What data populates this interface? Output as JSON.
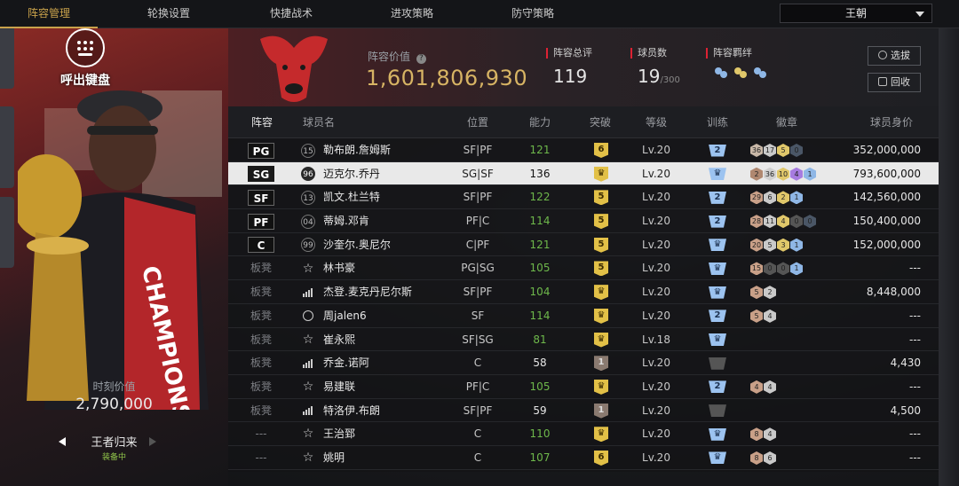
{
  "tabs": [
    {
      "label": "阵容管理",
      "active": true
    },
    {
      "label": "轮换设置",
      "active": false
    },
    {
      "label": "快捷战术",
      "active": false
    },
    {
      "label": "进攻策略",
      "active": false
    },
    {
      "label": "防守策略",
      "active": false
    }
  ],
  "lineup_select": {
    "value": "王朝"
  },
  "left": {
    "keyboard_label": "呼出键盘",
    "value_label": "时刻价值",
    "value": "2,790,000",
    "mode_label": "王者归来",
    "mode_sub": "装备中"
  },
  "header": {
    "lineup_value_label": "阵容价值",
    "lineup_value": "1,601,806,930",
    "total_rating_label": "阵容总评",
    "total_rating": "119",
    "player_count_label": "球员数",
    "player_count": "19",
    "player_count_max": "/300",
    "synergy_label": "阵容羁绊",
    "scout_button": "选拔",
    "recycle_button": "回收"
  },
  "columns": {
    "pos": "阵容",
    "name": "球员名",
    "position": "位置",
    "rating": "能力",
    "breakthrough": "突破",
    "level": "等级",
    "training": "训练",
    "badges": "徽章",
    "value": "球员身价"
  },
  "rows": [
    {
      "pos": "PG",
      "icon": "num",
      "num": "15",
      "name": "勒布朗.詹姆斯",
      "position": "SF|PF",
      "rating": "121",
      "rating_color": "green",
      "brk": "6",
      "brk_color": "gold",
      "level": "Lv.20",
      "train": "2",
      "train_dark": false,
      "badges": [
        [
          "36",
          "#c9b8a8"
        ],
        [
          "17",
          "#c9c9c9"
        ],
        [
          "5",
          "#e0c76a"
        ],
        [
          "0",
          "#4a5666"
        ]
      ],
      "value": "352,000,000"
    },
    {
      "pos": "SG",
      "icon": "num",
      "num": "96",
      "name": "迈克尔.乔丹",
      "position": "SG|SF",
      "rating": "136",
      "rating_color": "white",
      "brk": "♛",
      "brk_color": "gold",
      "level": "Lv.20",
      "train": "♛",
      "train_dark": false,
      "badges": [
        [
          "2",
          "#b08870"
        ],
        [
          "36",
          "#cfcfcf"
        ],
        [
          "10",
          "#e0c76a"
        ],
        [
          "4",
          "#a77ce0"
        ],
        [
          "1",
          "#8fb7e6"
        ]
      ],
      "value": "793,600,000",
      "selected": true
    },
    {
      "pos": "SF",
      "icon": "num",
      "num": "13",
      "name": "凯文.杜兰特",
      "position": "SF|PF",
      "rating": "122",
      "rating_color": "green",
      "brk": "5",
      "brk_color": "gold",
      "level": "Lv.20",
      "train": "2",
      "train_dark": false,
      "badges": [
        [
          "29",
          "#c9a088"
        ],
        [
          "6",
          "#c9c9c9"
        ],
        [
          "2",
          "#e0c76a"
        ],
        [
          "1",
          "#8fb7e6"
        ]
      ],
      "value": "142,560,000"
    },
    {
      "pos": "PF",
      "icon": "num",
      "num": "04",
      "name": "蒂姆.邓肯",
      "position": "PF|C",
      "rating": "114",
      "rating_color": "green",
      "brk": "5",
      "brk_color": "gold",
      "level": "Lv.20",
      "train": "2",
      "train_dark": false,
      "badges": [
        [
          "28",
          "#c9a088"
        ],
        [
          "11",
          "#c9c9c9"
        ],
        [
          "4",
          "#e0c76a"
        ],
        [
          "0",
          "#555"
        ],
        [
          "0",
          "#4a5666"
        ]
      ],
      "value": "150,400,000"
    },
    {
      "pos": "C",
      "icon": "num",
      "num": "99",
      "name": "沙奎尔.奥尼尔",
      "position": "C|PF",
      "rating": "121",
      "rating_color": "green",
      "brk": "5",
      "brk_color": "gold",
      "level": "Lv.20",
      "train": "♛",
      "train_dark": false,
      "badges": [
        [
          "20",
          "#c9a088"
        ],
        [
          "5",
          "#c9c9c9"
        ],
        [
          "3",
          "#e0c76a"
        ],
        [
          "1",
          "#8fb7e6"
        ]
      ],
      "value": "152,000,000"
    },
    {
      "pos": "板凳",
      "icon": "star",
      "num": "",
      "name": "林书豪",
      "position": "PG|SG",
      "rating": "105",
      "rating_color": "green",
      "brk": "5",
      "brk_color": "gold",
      "level": "Lv.20",
      "train": "♛",
      "train_dark": false,
      "badges": [
        [
          "15",
          "#c9a088"
        ],
        [
          "0",
          "#555"
        ],
        [
          "0",
          "#555"
        ],
        [
          "1",
          "#8fb7e6"
        ]
      ],
      "value": "---"
    },
    {
      "pos": "板凳",
      "icon": "sig",
      "num": "",
      "name": "杰登.麦克丹尼尔斯",
      "position": "SF|PF",
      "rating": "104",
      "rating_color": "green",
      "brk": "♛",
      "brk_color": "gold",
      "level": "Lv.20",
      "train": "♛",
      "train_dark": false,
      "badges": [
        [
          "5",
          "#c9a088"
        ],
        [
          "2",
          "#c9c9c9"
        ]
      ],
      "value": "8,448,000"
    },
    {
      "pos": "板凳",
      "icon": "person",
      "num": "",
      "name": "周jalen6",
      "position": "SF",
      "rating": "114",
      "rating_color": "green",
      "brk": "♛",
      "brk_color": "gold",
      "level": "Lv.20",
      "train": "2",
      "train_dark": false,
      "badges": [
        [
          "5",
          "#c9a088"
        ],
        [
          "4",
          "#c9c9c9"
        ]
      ],
      "value": "---"
    },
    {
      "pos": "板凳",
      "icon": "star",
      "num": "",
      "name": "崔永熙",
      "position": "SF|SG",
      "rating": "81",
      "rating_color": "green",
      "brk": "♛",
      "brk_color": "gold",
      "level": "Lv.18",
      "train": "♛",
      "train_dark": false,
      "badges": [],
      "value": "---"
    },
    {
      "pos": "板凳",
      "icon": "sig",
      "num": "",
      "name": "乔金.诺阿",
      "position": "C",
      "rating": "58",
      "rating_color": "white",
      "brk": "1",
      "brk_color": "gray",
      "level": "Lv.20",
      "train": "",
      "train_dark": true,
      "badges": [],
      "value": "4,430"
    },
    {
      "pos": "板凳",
      "icon": "star",
      "num": "",
      "name": "易建联",
      "position": "PF|C",
      "rating": "105",
      "rating_color": "green",
      "brk": "♛",
      "brk_color": "gold",
      "level": "Lv.20",
      "train": "2",
      "train_dark": false,
      "badges": [
        [
          "4",
          "#c9a088"
        ],
        [
          "4",
          "#c9c9c9"
        ]
      ],
      "value": "---"
    },
    {
      "pos": "板凳",
      "icon": "sig",
      "num": "",
      "name": "特洛伊.布朗",
      "position": "SF|PF",
      "rating": "59",
      "rating_color": "white",
      "brk": "1",
      "brk_color": "gray",
      "level": "Lv.20",
      "train": "",
      "train_dark": true,
      "badges": [],
      "value": "4,500"
    },
    {
      "pos": "---",
      "icon": "star",
      "num": "",
      "name": "王治郅",
      "position": "C",
      "rating": "110",
      "rating_color": "green",
      "brk": "♛",
      "brk_color": "gold",
      "level": "Lv.20",
      "train": "♛",
      "train_dark": false,
      "badges": [
        [
          "8",
          "#c9a088"
        ],
        [
          "4",
          "#c9c9c9"
        ]
      ],
      "value": "---"
    },
    {
      "pos": "---",
      "icon": "star",
      "num": "",
      "name": "姚明",
      "position": "C",
      "rating": "107",
      "rating_color": "green",
      "brk": "6",
      "brk_color": "gold",
      "level": "Lv.20",
      "train": "♛",
      "train_dark": false,
      "badges": [
        [
          "8",
          "#c9a088"
        ],
        [
          "6",
          "#c9c9c9"
        ]
      ],
      "value": "---"
    }
  ]
}
